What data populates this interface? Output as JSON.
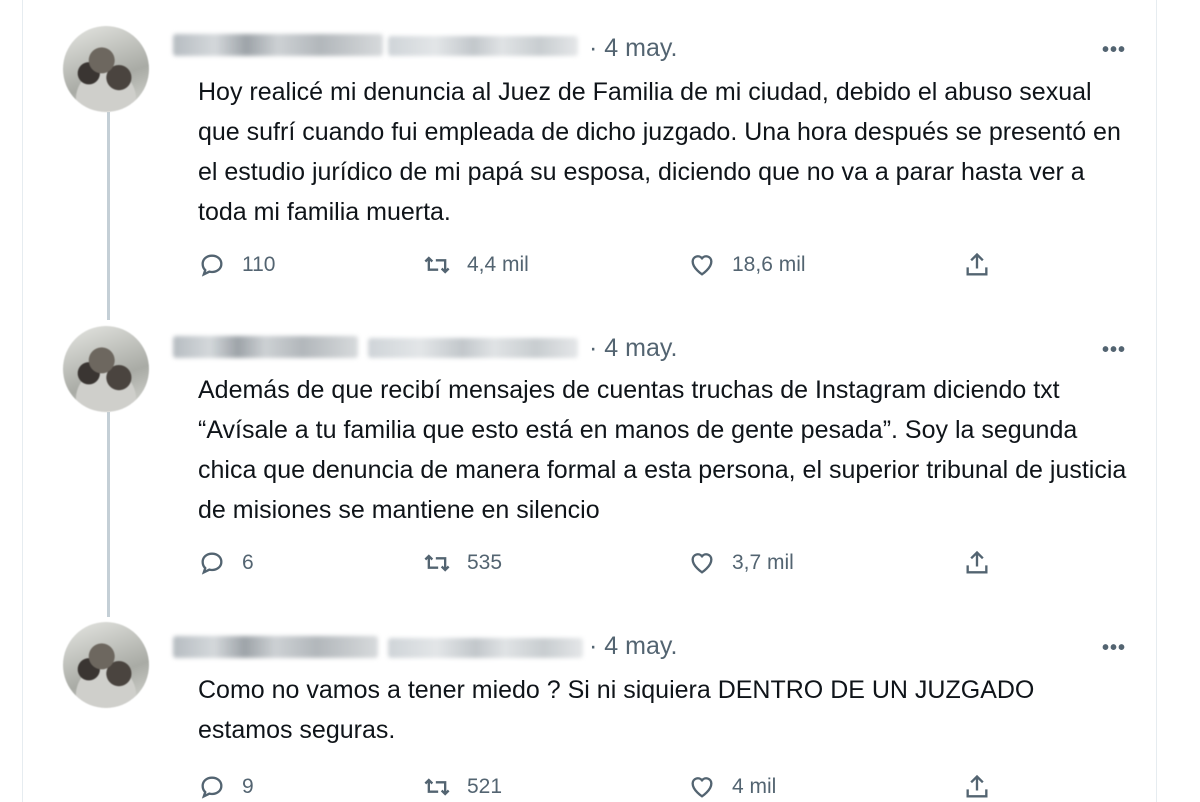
{
  "tweets": [
    {
      "date": "· 4 may.",
      "text": "Hoy realicé mi denuncia al Juez de Familia de mi ciudad, debido el abuso sexual que sufrí cuando fui empleada de dicho juzgado. Una hora después se presentó en el estudio jurídico de mi papá su esposa, diciendo que no va a parar hasta ver a toda mi familia muerta.",
      "replies": "110",
      "retweets": "4,4 mil",
      "likes": "18,6 mil"
    },
    {
      "date": "· 4 may.",
      "text": "Además de que recibí mensajes de cuentas truchas de Instagram diciendo txt “Avísale a tu familia que esto está en manos de gente pesada”. Soy la segunda chica que denuncia de manera formal a esta persona, el superior tribunal de justicia de misiones se mantiene en silencio",
      "replies": "6",
      "retweets": "535",
      "likes": "3,7 mil"
    },
    {
      "date": "· 4 may.",
      "text": "Como no vamos a tener miedo ? Si ni siquiera DENTRO DE UN JUZGADO estamos seguras.",
      "replies": "9",
      "retweets": "521",
      "likes": "4 mil"
    }
  ],
  "icons": {
    "more": "more-icon",
    "reply": "reply-icon",
    "retweet": "retweet-icon",
    "like": "like-icon",
    "share": "share-icon"
  },
  "colors": {
    "text": "#0f1419",
    "secondary": "#536471",
    "thread_line": "#c4cfd6"
  }
}
